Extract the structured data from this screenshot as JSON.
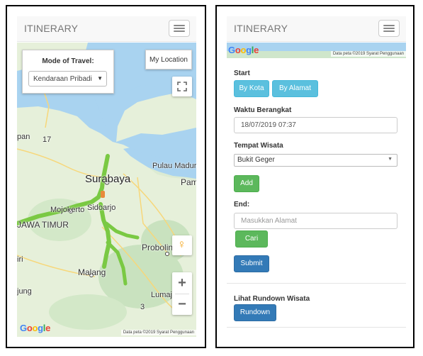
{
  "left": {
    "navbar": {
      "brand": "ITINERARY"
    },
    "mode_box": {
      "title": "Mode of Travel:",
      "selected": "Kendaraan Pribadi"
    },
    "my_location_label": "My Location",
    "map_labels": {
      "surabaya": "Surabaya",
      "pulau_madura": "Pulau Madur",
      "pamekasan": "Pam",
      "mojokerto": "Mojokerto",
      "sidoarjo": "Sidoarjo",
      "jawa_timur": "JAWA TIMUR",
      "probolinggo": "Probolinggo",
      "malang": "Malang",
      "lumajang": "Lumajang",
      "jombang": "pan",
      "kediri": "iri",
      "tulungagung": "jung",
      "road_17": "17",
      "road_3": "3"
    },
    "zoom": {
      "in": "+",
      "out": "−"
    },
    "attribution": "Data peta ©2019   Syarat Penggunaan"
  },
  "right": {
    "navbar": {
      "brand": "ITINERARY"
    },
    "attribution": "Data peta ©2019   Syarat Penggunaan",
    "form": {
      "start_label": "Start",
      "by_kota": "By Kota",
      "by_alamat": "By Alamat",
      "waktu_label": "Waktu Berangkat",
      "waktu_value": "18/07/2019 07:37",
      "tempat_label": "Tempat Wisata",
      "tempat_selected": "Bukit Geger",
      "add_label": "Add",
      "end_label": "End:",
      "end_placeholder": "Masukkan Alamat",
      "cari_label": "Cari",
      "submit_label": "Submit",
      "rundown_heading": "Lihat Rundown Wisata",
      "rundown_label": "Rundown"
    }
  },
  "google_logo": {
    "g1": "G",
    "g2": "o",
    "g3": "o",
    "g4": "g",
    "g5": "l",
    "g6": "e"
  },
  "colors": {
    "route": "#7ac943",
    "info": "#5bc0de",
    "success": "#5cb85c",
    "primary": "#337ab7"
  }
}
